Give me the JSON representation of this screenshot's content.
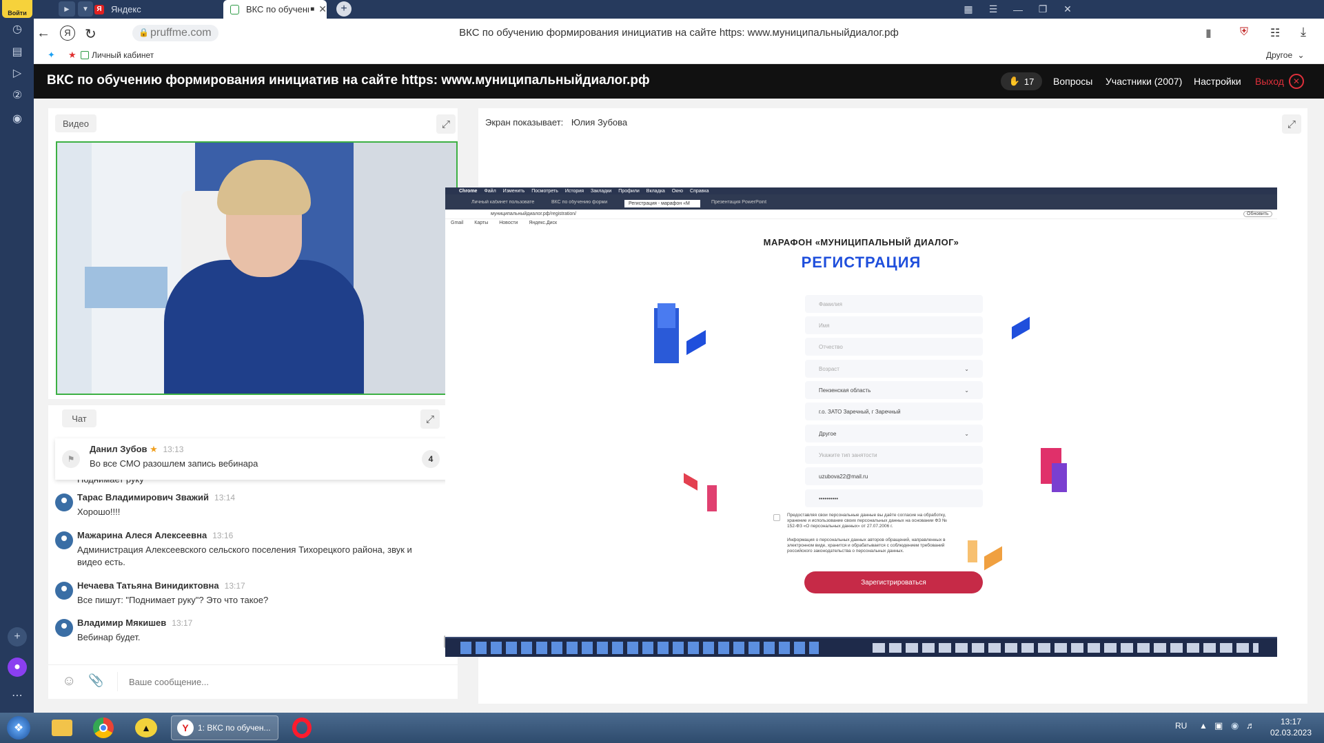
{
  "browser": {
    "login_label": "Войти",
    "tabs": [
      {
        "label": "Яндекс",
        "active": false
      },
      {
        "label": "ВКС по обучению ф",
        "active": true
      }
    ],
    "new_tab_symbol": "+",
    "url": "pruffme.com",
    "page_title": "ВКС по обучению формирования инициатив на сайте https: www.муниципальныйдиалог.рф",
    "bookmarks": [
      "Личный кабинет"
    ],
    "bookmarks_other": "Другое"
  },
  "app": {
    "title": "ВКС по обучению формирования инициатив на сайте https: www.муниципальныйдиалог.рф",
    "hands_count": "17",
    "questions": "Вопросы",
    "participants": "Участники (2007)",
    "settings": "Настройки",
    "exit": "Выход"
  },
  "video": {
    "label": "Видео"
  },
  "chat": {
    "label": "Чат",
    "pinned": {
      "name": "Данил Зубов",
      "time": "13:13",
      "text": "Во все СМО разошлем запись вебинара",
      "badge": "4"
    },
    "partial_text": "Поднимает руку",
    "messages": [
      {
        "name": "Тарас Владимирович Зважий",
        "time": "13:14",
        "text": "Хорошо!!!!"
      },
      {
        "name": "Мажарина Алеся Алексеевна",
        "time": "13:16",
        "text": "Администрация Алексеевского сельского поселения Тихорецкого района, звук и видео есть."
      },
      {
        "name": "Нечаева Татьяна Винидиктовна",
        "time": "13:17",
        "text": "Все пишут: \"Поднимает руку\"? Это что такое?"
      },
      {
        "name": "Владимир Мякишев",
        "time": "13:17",
        "text": "Вебинар будет."
      }
    ],
    "input_placeholder": "Ваше сообщение..."
  },
  "screen_share": {
    "label": "Экран показывает:",
    "presenter": "Юлия Зубова",
    "inner": {
      "menubar": [
        "Chrome",
        "Файл",
        "Изменить",
        "Посмотреть",
        "История",
        "Закладки",
        "Профили",
        "Вкладка",
        "Окно",
        "Справка"
      ],
      "tabs": [
        "Личный кабинет пользовате",
        "ВКС по обучению форми",
        "Регистрация - марафон «М",
        "Презентация PowerPoint"
      ],
      "url": "муниципальныйдиалог.рф/registration/",
      "update": "Обновить",
      "bookmarks": [
        "Gmail",
        "Карты",
        "Новости",
        "Яндекс.Диск"
      ],
      "marathon": "МАРАФОН «МУНИЦИПАЛЬНЫЙ ДИАЛОГ»",
      "heading": "РЕГИСТРАЦИЯ",
      "fields": [
        {
          "text": "Фамилия",
          "placeholder": true,
          "dropdown": false
        },
        {
          "text": "Имя",
          "placeholder": true,
          "dropdown": false
        },
        {
          "text": "Отчество",
          "placeholder": true,
          "dropdown": false
        },
        {
          "text": "Возраст",
          "placeholder": true,
          "dropdown": true
        },
        {
          "text": "Пензенская область",
          "placeholder": false,
          "dropdown": true
        },
        {
          "text": "г.о. ЗАТО Заречный, г Заречный",
          "placeholder": false,
          "dropdown": false
        },
        {
          "text": "Другое",
          "placeholder": false,
          "dropdown": true
        },
        {
          "text": "Укажите тип занятости",
          "placeholder": true,
          "dropdown": false
        },
        {
          "text": "uzubova22@mail.ru",
          "placeholder": false,
          "dropdown": false
        },
        {
          "text": "••••••••••",
          "placeholder": false,
          "dropdown": false
        }
      ],
      "consent1": "Предоставляя свои персональные данные вы даёте согласие на обработку, хранение и использование своих персональных данных на основании ФЗ № 152-ФЗ «О персональных данных» от 27.07.2006 г.",
      "consent2": "Информация о персональных данных авторов обращений, направленных в электронном виде, хранится и обрабатывается с соблюдением требований российского законодательства о персональных данных.",
      "submit": "Зарегистрироваться"
    }
  },
  "taskbar": {
    "active_task": "1: ВКС по обучен...",
    "lang": "RU",
    "time": "13:17",
    "date": "02.03.2023"
  },
  "colors": {
    "browser_chrome": "#263a5d",
    "header_bg": "#111111",
    "exit_red": "#e0303b",
    "accent_blue": "#1f4fdc",
    "submit_red": "#c62a47",
    "video_border": "#3cb043"
  }
}
